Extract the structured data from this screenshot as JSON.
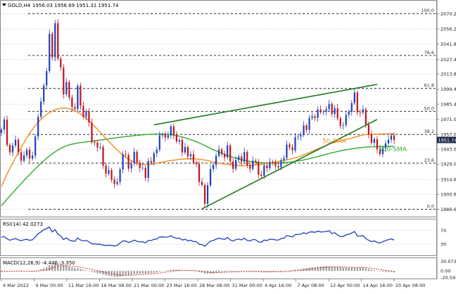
{
  "header": {
    "instrument": "GOLD,H4",
    "ohlc": "1956.03 1956.69 1951.31 1951.74"
  },
  "colors": {
    "bull": "#1f3fbf",
    "bear": "#c0131b",
    "sma50": "#f2922a",
    "sma100": "#3bb03b",
    "trend": "#1f7a1f",
    "price_box": "#1a2a4a",
    "rsi": "#1f3fbf",
    "macd_hist": "#9a9a9a",
    "macd_signal": "#d43030"
  },
  "chart_data": [
    {
      "type": "candlestick",
      "title": "GOLD,H4",
      "ylim": [
        1881,
        2082
      ],
      "x": [
        "4 Mar 2022",
        "9 Mar 00:00",
        "11 Mar 16:00",
        "16 Mar 08:00",
        "21 Mar 00:00",
        "23 Mar 16:00",
        "28 Mar 08:00",
        "31 Mar 00:00",
        "4 Apr 16:00",
        "7 Apr 08:00",
        "12 Apr 00:00",
        "14 Apr 16:00",
        "20 Apr 08:00"
      ],
      "y_ticks": [
        2070.2,
        2056.2,
        2041.8,
        2027.4,
        2013.8,
        1999.4,
        1985.4,
        1971.0,
        1957.0,
        1943.0,
        1929.0,
        1914.6,
        1900.6,
        1886.6
      ],
      "last_price": 1951.74,
      "fibonacci": [
        {
          "level": "100.0",
          "price": 2070.6
        },
        {
          "level": "78.6",
          "price": 2031.2
        },
        {
          "level": "61.8",
          "price": 2000.3
        },
        {
          "level": "50.0",
          "price": 1978.6
        },
        {
          "level": "38.2",
          "price": 1956.9
        },
        {
          "level": "23.6",
          "price": 1930.0
        },
        {
          "level": "0.0",
          "price": 1886.6
        }
      ],
      "indicators": [
        {
          "name": "50-SMA",
          "color": "#f2922a"
        },
        {
          "name": "100-SMA",
          "color": "#3bb03b"
        }
      ],
      "series": [
        {
          "name": "close",
          "values": [
            1961.5,
            1970.8,
            1947.0,
            1940.0,
            1946.5,
            1952.0,
            1940.2,
            1932.1,
            1937.4,
            1942.6,
            1934.3,
            1937.0,
            1955.0,
            1973.6,
            1987.8,
            2003.0,
            2016.5,
            2051.6,
            2029.5,
            2061.6,
            2028.2,
            2019.9,
            1994.6,
            2006.2,
            1991.7,
            1982.7,
            1980.8,
            2002.7,
            1983.9,
            1973.5,
            1978.8,
            1968.1,
            1949.9,
            1949.3,
            1944.6,
            1945.2,
            1927.5,
            1920.1,
            1923.4,
            1914.6,
            1910.4,
            1912.3,
            1924.1,
            1938.3,
            1937.7,
            1924.9,
            1929.6,
            1940.6,
            1930.4,
            1925.3,
            1925.5,
            1916.0,
            1932.0,
            1930.7,
            1939.3,
            1942.6,
            1956.1,
            1956.9,
            1954.0,
            1956.1,
            1964.5,
            1956.3,
            1950.3,
            1951.8,
            1940.0,
            1945.1,
            1936.3,
            1938.3,
            1930.6,
            1929.2,
            1912.3,
            1909.5,
            1891.7,
            1909.2,
            1924.4,
            1928.2,
            1936.8,
            1942.7,
            1938.8,
            1935.4,
            1946.6,
            1931.5,
            1924.6,
            1933.0,
            1936.2,
            1931.4,
            1940.4,
            1928.0,
            1924.6,
            1932.3,
            1931.2,
            1919.2,
            1918.0,
            1927.9,
            1925.2,
            1931.1,
            1930.8,
            1927.4,
            1926.1,
            1932.8,
            1934.7,
            1947.5,
            1944.9,
            1941.9,
            1954.5,
            1955.0,
            1956.5,
            1965.4,
            1961.3,
            1972.4,
            1974.1,
            1972.5,
            1980.4,
            1977.9,
            1978.4,
            1980.7,
            1985.7,
            1976.2,
            1981.6,
            1972.1,
            1965.2,
            1965.7,
            1975.3,
            1978.3,
            1986.4,
            1996.4,
            1977.8,
            1977.5,
            1980.6,
            1966.1,
            1957.1,
            1949.1,
            1952.6,
            1943.0,
            1938.5,
            1944.0,
            1948.5,
            1952.0,
            1956.0,
            1951.7
          ]
        },
        {
          "name": "50-SMA",
          "values": [
            1908.0,
            1913.8,
            1919.6,
            1925.0,
            1930.0,
            1935.1,
            1939.9,
            1944.6,
            1949.2,
            1953.6,
            1957.8,
            1961.6,
            1965.1,
            1968.3,
            1971.1,
            1973.6,
            1975.7,
            1977.5,
            1979.0,
            1980.2,
            1981.0,
            1981.5,
            1981.7,
            1981.6,
            1981.1,
            1980.3,
            1979.2,
            1977.8,
            1976.2,
            1974.3,
            1972.2,
            1969.8,
            1967.2,
            1964.5,
            1961.7,
            1958.9,
            1956.0,
            1953.2,
            1950.4,
            1947.6,
            1944.9,
            1942.4,
            1939.9,
            1937.6,
            1935.6,
            1933.8,
            1932.2,
            1931.0,
            1930.0,
            1929.3,
            1928.9,
            1928.7,
            1928.8,
            1929.1,
            1929.5,
            1930.0,
            1930.5,
            1931.0,
            1931.5,
            1931.9,
            1932.4,
            1932.8,
            1933.1,
            1933.5,
            1933.7,
            1933.9,
            1934.0,
            1934.0,
            1934.0,
            1933.9,
            1933.6,
            1933.3,
            1932.9,
            1932.4,
            1931.8,
            1931.1,
            1930.6,
            1930.1,
            1929.6,
            1929.1,
            1928.7,
            1928.4,
            1928.1,
            1927.9,
            1927.7,
            1927.6,
            1927.6,
            1927.7,
            1927.8,
            1928.0,
            1928.3,
            1928.6,
            1928.9,
            1929.3,
            1929.7,
            1930.2,
            1930.6,
            1931.1,
            1931.6,
            1932.0,
            1932.5,
            1933.1,
            1933.6,
            1934.3,
            1935.0,
            1935.8,
            1936.7,
            1937.8,
            1938.9,
            1940.0,
            1941.1,
            1942.2,
            1943.3,
            1944.4,
            1945.5,
            1946.6,
            1947.7,
            1948.7,
            1949.6,
            1950.4,
            1951.0,
            1951.6,
            1952.2,
            1952.8,
            1953.5,
            1954.3,
            1955.1,
            1955.8,
            1956.5,
            1956.8,
            1957.0,
            1957.1,
            1957.2,
            1957.3,
            1957.3,
            1957.4,
            1957.4,
            1957.5,
            1957.5,
            1957.5
          ]
        },
        {
          "name": "100-SMA",
          "values": [
            1890.0,
            1893.0,
            1896.0,
            1899.0,
            1902.0,
            1905.0,
            1907.9,
            1910.8,
            1913.7,
            1916.5,
            1919.3,
            1922.0,
            1924.7,
            1927.3,
            1929.8,
            1932.2,
            1934.5,
            1936.7,
            1938.7,
            1940.6,
            1942.3,
            1943.8,
            1945.1,
            1946.2,
            1947.1,
            1947.8,
            1948.4,
            1948.9,
            1949.3,
            1949.6,
            1949.9,
            1950.2,
            1950.5,
            1950.8,
            1951.2,
            1951.6,
            1952.0,
            1952.4,
            1952.8,
            1953.2,
            1953.6,
            1954.0,
            1954.3,
            1954.6,
            1954.9,
            1955.2,
            1955.5,
            1955.8,
            1956.1,
            1956.4,
            1956.6,
            1956.8,
            1957.0,
            1957.1,
            1957.2,
            1957.3,
            1957.3,
            1957.3,
            1957.2,
            1957.0,
            1956.7,
            1956.3,
            1955.8,
            1955.2,
            1954.5,
            1953.8,
            1953.0,
            1952.1,
            1951.1,
            1950.1,
            1949.0,
            1947.8,
            1946.5,
            1945.2,
            1943.9,
            1942.6,
            1941.4,
            1940.2,
            1939.1,
            1938.1,
            1937.1,
            1936.2,
            1935.4,
            1934.6,
            1933.9,
            1933.2,
            1932.6,
            1932.1,
            1931.6,
            1931.2,
            1930.9,
            1930.6,
            1930.4,
            1930.2,
            1930.1,
            1930.0,
            1930.0,
            1930.0,
            1930.1,
            1930.2,
            1930.4,
            1930.6,
            1930.9,
            1931.2,
            1931.6,
            1932.0,
            1932.5,
            1933.0,
            1933.6,
            1934.2,
            1934.8,
            1935.5,
            1936.2,
            1936.9,
            1937.6,
            1938.3,
            1939.0,
            1939.7,
            1940.3,
            1940.9,
            1941.5,
            1942.0,
            1942.5,
            1943.0,
            1943.4,
            1943.8,
            1944.2,
            1944.5,
            1944.8,
            1945.0,
            1945.2,
            1945.3,
            1945.4,
            1945.5,
            1945.5,
            1945.6,
            1945.6,
            1945.7,
            1945.7,
            1945.8
          ]
        }
      ],
      "trendlines": [
        {
          "name": "upper",
          "from": [
            54,
            1966.0
          ],
          "to": [
            133,
            2004.0
          ]
        },
        {
          "name": "lower",
          "from": [
            71,
            1887.0
          ],
          "to": [
            133,
            1971.0
          ]
        }
      ]
    },
    {
      "type": "line",
      "title": "RSI(14) 42.0273",
      "ylim": [
        0,
        100
      ],
      "y_ticks": [
        70,
        30
      ],
      "series": [
        {
          "name": "RSI(14)",
          "values": [
            50.2,
            52.3,
            45.9,
            41.7,
            44.3,
            46.7,
            42.8,
            40.5,
            43.0,
            44.5,
            41.5,
            43.0,
            51.4,
            60.5,
            66.0,
            72.2,
            75.3,
            79.9,
            65.5,
            72.7,
            58.8,
            54.7,
            43.7,
            48.7,
            42.3,
            39.7,
            38.8,
            48.4,
            42.4,
            39.5,
            41.2,
            37.1,
            31.4,
            31.3,
            30.0,
            30.3,
            27.6,
            25.9,
            27.6,
            26.1,
            25.1,
            26.7,
            33.7,
            39.8,
            39.3,
            35.1,
            37.7,
            42.2,
            38.6,
            37.0,
            37.3,
            34.4,
            41.1,
            40.8,
            44.3,
            45.4,
            51.3,
            51.6,
            50.2,
            51.3,
            54.6,
            49.8,
            47.1,
            48.0,
            42.2,
            44.7,
            40.3,
            41.7,
            38.2,
            37.5,
            30.1,
            29.3,
            24.1,
            32.1,
            39.0,
            40.9,
            44.9,
            47.5,
            45.7,
            44.1,
            49.8,
            42.6,
            39.4,
            43.7,
            45.2,
            42.6,
            47.6,
            41.3,
            39.6,
            43.8,
            43.0,
            36.7,
            36.0,
            42.3,
            41.0,
            44.6,
            44.5,
            42.7,
            42.1,
            46.3,
            47.5,
            55.4,
            53.5,
            51.3,
            58.2,
            58.4,
            59.3,
            63.6,
            60.4,
            65.4,
            66.0,
            64.6,
            68.2,
            65.8,
            66.1,
            67.2,
            69.4,
            61.1,
            63.6,
            56.8,
            52.2,
            52.5,
            57.5,
            59.0,
            62.8,
            66.9,
            54.0,
            53.8,
            55.2,
            46.3,
            41.5,
            37.7,
            40.0,
            35.5,
            33.7,
            37.6,
            40.8,
            43.2,
            45.7,
            42.0
          ]
        }
      ]
    },
    {
      "type": "bar",
      "title": "MACD(12,26,9) -4.446 -3.350",
      "ylim": [
        -24,
        38
      ],
      "y_ticks": [
        30.073,
        0.0,
        -20.592
      ],
      "series": [
        {
          "name": "MACD(12,26,9)",
          "values": [
            -3.0,
            -1.2,
            -0.4,
            -0.5,
            -0.1,
            0.6,
            0.1,
            -0.8,
            -1.0,
            -0.9,
            -1.6,
            -1.8,
            -0.5,
            1.8,
            4.7,
            8.2,
            11.9,
            17.6,
            19.9,
            24.0,
            23.4,
            21.9,
            18.5,
            16.6,
            13.8,
            10.9,
            8.4,
            8.0,
            6.1,
            3.8,
            2.3,
            0.3,
            -2.8,
            -5.2,
            -7.3,
            -8.8,
            -11.3,
            -13.7,
            -15.1,
            -16.8,
            -18.2,
            -18.9,
            -18.2,
            -16.0,
            -14.0,
            -13.2,
            -12.0,
            -10.0,
            -9.1,
            -8.7,
            -8.3,
            -8.8,
            -7.8,
            -7.0,
            -5.6,
            -4.2,
            -2.0,
            -0.2,
            1.0,
            2.1,
            3.6,
            4.1,
            4.0,
            4.0,
            3.0,
            2.6,
            1.5,
            0.8,
            -0.3,
            -1.3,
            -3.4,
            -5.3,
            -8.2,
            -8.9,
            -8.3,
            -7.5,
            -6.1,
            -4.5,
            -3.5,
            -2.9,
            -1.5,
            -1.6,
            -2.2,
            -1.9,
            -1.4,
            -1.4,
            -0.6,
            -1.2,
            -1.9,
            -1.8,
            -1.8,
            -2.9,
            -3.8,
            -3.6,
            -3.6,
            -3.0,
            -2.6,
            -2.5,
            -2.5,
            -1.8,
            -1.1,
            0.5,
            1.6,
            2.2,
            3.7,
            4.8,
            5.8,
            7.4,
            8.3,
            9.9,
            11.2,
            12.0,
            13.2,
            13.8,
            14.1,
            14.4,
            14.9,
            14.3,
            14.1,
            13.1,
            11.6,
            10.3,
            10.0,
            9.9,
            10.4,
            11.5,
            10.8,
            10.1,
            9.7,
            8.1,
            6.0,
            3.8,
            2.3,
            0.4,
            -1.5,
            -2.5,
            -3.0,
            -3.1,
            -3.0,
            -4.4
          ]
        },
        {
          "name": "Signal",
          "values": [
            -2.0,
            -1.8,
            -1.5,
            -1.3,
            -1.0,
            -0.7,
            -0.6,
            -0.6,
            -0.7,
            -0.8,
            -0.9,
            -1.1,
            -1.0,
            -0.4,
            0.6,
            2.1,
            4.1,
            6.8,
            9.4,
            12.3,
            14.5,
            16.0,
            16.5,
            16.5,
            16.0,
            15.0,
            13.7,
            12.6,
            11.3,
            9.8,
            8.3,
            6.7,
            4.8,
            2.8,
            0.8,
            -1.1,
            -3.1,
            -5.2,
            -7.2,
            -9.1,
            -10.9,
            -12.5,
            -13.6,
            -14.1,
            -14.1,
            -13.9,
            -13.5,
            -12.8,
            -12.1,
            -11.4,
            -10.8,
            -10.4,
            -9.9,
            -9.3,
            -8.6,
            -7.7,
            -6.6,
            -5.3,
            -4.1,
            -2.9,
            -1.6,
            -0.5,
            0.4,
            1.1,
            1.5,
            1.7,
            1.7,
            1.5,
            1.1,
            0.6,
            -0.2,
            -1.2,
            -2.6,
            -3.8,
            -4.7,
            -5.3,
            -5.4,
            -5.2,
            -4.9,
            -4.5,
            -3.9,
            -3.5,
            -3.2,
            -3.0,
            -2.7,
            -2.4,
            -2.0,
            -1.9,
            -1.9,
            -1.9,
            -1.9,
            -2.1,
            -2.5,
            -2.7,
            -2.9,
            -2.9,
            -2.9,
            -2.8,
            -2.7,
            -2.5,
            -2.2,
            -1.6,
            -1.0,
            -0.4,
            0.4,
            1.3,
            2.2,
            3.3,
            4.3,
            5.4,
            6.6,
            7.7,
            8.8,
            9.8,
            10.6,
            11.4,
            12.1,
            12.5,
            12.8,
            12.9,
            12.6,
            12.1,
            11.7,
            11.3,
            11.1,
            11.1,
            11.1,
            10.9,
            10.7,
            10.2,
            9.4,
            8.3,
            7.1,
            5.8,
            4.3,
            2.9,
            1.7,
            0.7,
            -0.0,
            -3.35
          ]
        }
      ]
    }
  ],
  "panes": {
    "rsi_label": "RSI(14) 42.0273",
    "macd_label": "MACD(12,26,9) -4.446 -3.350"
  }
}
